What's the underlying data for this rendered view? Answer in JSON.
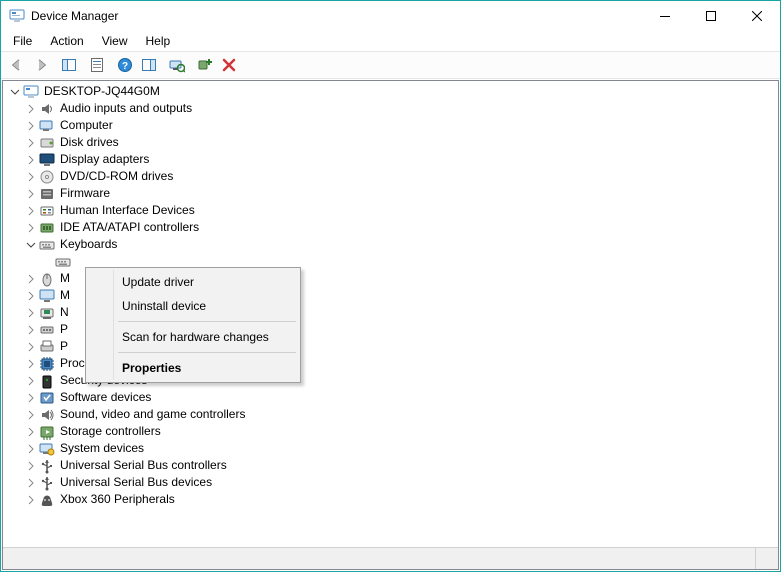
{
  "window": {
    "title": "Device Manager"
  },
  "menubar": {
    "items": [
      "File",
      "Action",
      "View",
      "Help"
    ]
  },
  "root": {
    "label": "DESKTOP-JQ44G0M"
  },
  "categories": [
    {
      "label": "Audio inputs and outputs",
      "icon": "audio",
      "expanded": false
    },
    {
      "label": "Computer",
      "icon": "computer",
      "expanded": false
    },
    {
      "label": "Disk drives",
      "icon": "disk",
      "expanded": false
    },
    {
      "label": "Display adapters",
      "icon": "display",
      "expanded": false
    },
    {
      "label": "DVD/CD-ROM drives",
      "icon": "dvd",
      "expanded": false
    },
    {
      "label": "Firmware",
      "icon": "firmware",
      "expanded": false
    },
    {
      "label": "Human Interface Devices",
      "icon": "hid",
      "expanded": false
    },
    {
      "label": "IDE ATA/ATAPI controllers",
      "icon": "ide",
      "expanded": false
    },
    {
      "label": "Keyboards",
      "icon": "keyboard",
      "expanded": true,
      "children": [
        {
          "label": "",
          "icon": "keyboard"
        }
      ]
    },
    {
      "label": "M",
      "icon": "mouse",
      "expanded": false
    },
    {
      "label": "M",
      "icon": "monitor",
      "expanded": false
    },
    {
      "label": "N",
      "icon": "network",
      "expanded": false
    },
    {
      "label": "P",
      "icon": "port",
      "expanded": false
    },
    {
      "label": "P",
      "icon": "printqueue",
      "expanded": false
    },
    {
      "label": "Processors",
      "icon": "processor",
      "expanded": false
    },
    {
      "label": "Security devices",
      "icon": "security",
      "expanded": false
    },
    {
      "label": "Software devices",
      "icon": "software",
      "expanded": false
    },
    {
      "label": "Sound, video and game controllers",
      "icon": "sound",
      "expanded": false
    },
    {
      "label": "Storage controllers",
      "icon": "storage",
      "expanded": false
    },
    {
      "label": "System devices",
      "icon": "system",
      "expanded": false
    },
    {
      "label": "Universal Serial Bus controllers",
      "icon": "usb",
      "expanded": false
    },
    {
      "label": "Universal Serial Bus devices",
      "icon": "usb",
      "expanded": false
    },
    {
      "label": "Xbox 360 Peripherals",
      "icon": "xbox",
      "expanded": false
    }
  ],
  "context_menu": {
    "items": [
      {
        "label": "Update driver",
        "bold": false
      },
      {
        "label": "Uninstall device",
        "bold": false
      },
      {
        "separator": true
      },
      {
        "label": "Scan for hardware changes",
        "bold": false
      },
      {
        "separator": true
      },
      {
        "label": "Properties",
        "bold": true
      }
    ]
  }
}
